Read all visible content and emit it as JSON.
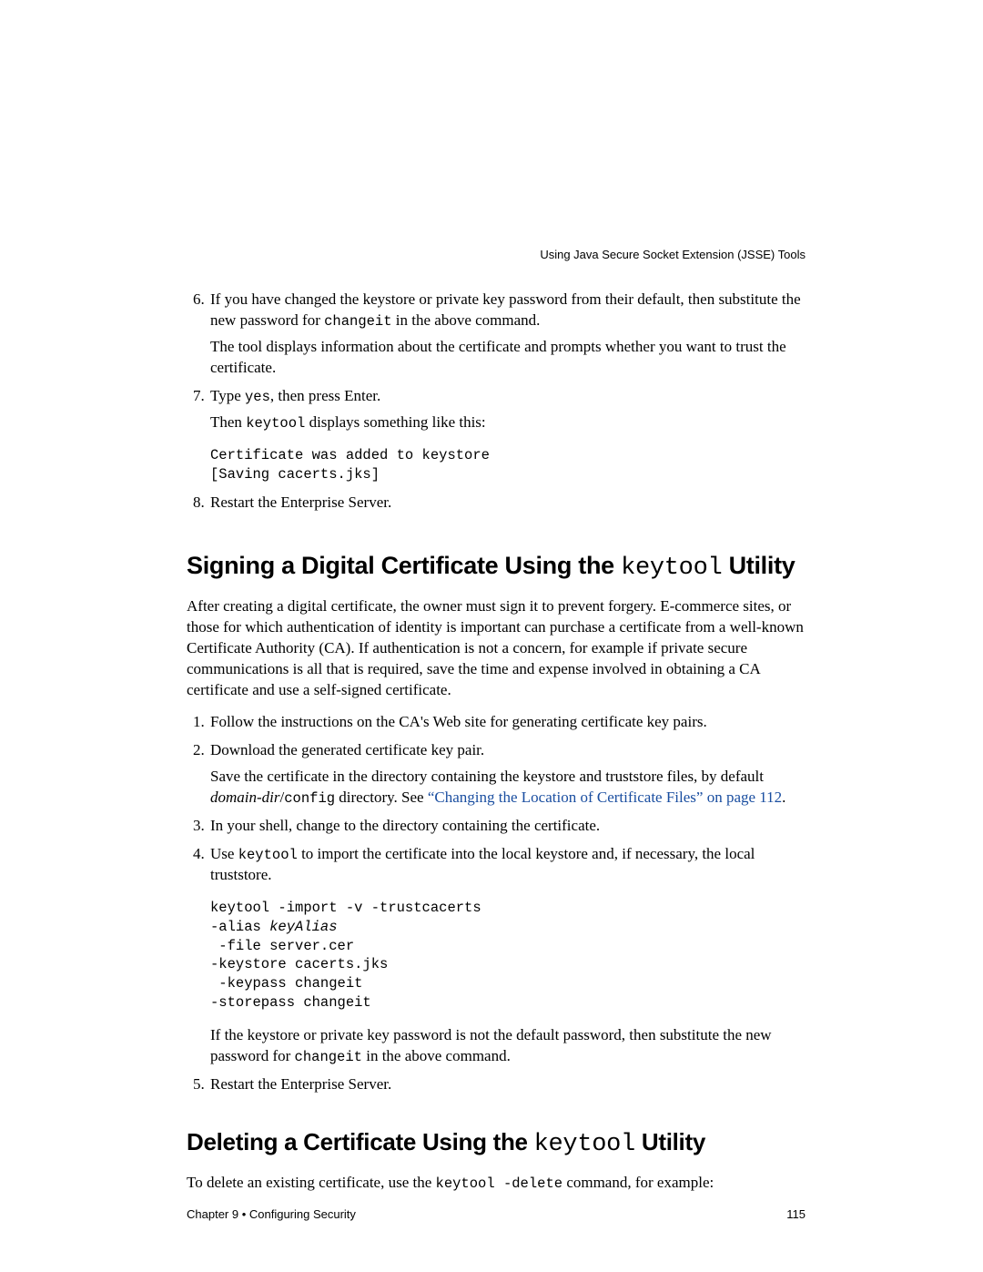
{
  "running_head": "Using Java Secure Socket Extension (JSSE) Tools",
  "list1": {
    "start": 6,
    "items": [
      {
        "text_before": "If you have changed the keystore or private key password from their default, then substitute the new password for ",
        "code1": "changeit",
        "text_after_code1": " in the above command.",
        "para2": "The tool displays information about the certificate and prompts whether you want to trust the certificate."
      },
      {
        "text_before": "Type ",
        "code1": "yes",
        "text_after_code1": ", then press Enter.",
        "para2_before": "Then ",
        "para2_code": "keytool",
        "para2_after": " displays something like this:",
        "pre": "Certificate was added to keystore\n[Saving cacerts.jks]"
      },
      {
        "text_before": "Restart the Enterprise Server."
      }
    ]
  },
  "h2a_before": "Signing a Digital Certificate Using the ",
  "h2a_code": "keytool",
  "h2a_after": " Utility",
  "para_after_h2a": "After creating a digital certificate, the owner must sign it to prevent forgery. E-commerce sites, or those for which authentication of identity is important can purchase a certificate from a well-known Certificate Authority (CA). If authentication is not a concern, for example if private secure communications is all that is required, save the time and expense involved in obtaining a CA certificate and use a self-signed certificate.",
  "list2": {
    "items": [
      {
        "text": "Follow the instructions on the CA's Web site for generating certificate key pairs."
      },
      {
        "text": "Download the generated certificate key pair.",
        "para2_before": "Save the certificate in the directory containing the keystore and truststore files, by default ",
        "para2_italic": "domain-dir",
        "para2_slash": "/",
        "para2_code": "config",
        "para2_mid": " directory. See ",
        "para2_link": "“Changing the Location of Certificate Files” on page 112",
        "para2_end": "."
      },
      {
        "text": "In your shell, change to the directory containing the certificate."
      },
      {
        "text_before": "Use ",
        "code1": "keytool",
        "text_after": " to import the certificate into the local keystore and, if necessary, the local truststore.",
        "pre_before": "keytool -import -v -trustcacerts\n-alias ",
        "pre_italic": "keyAlias",
        "pre_after": "\n -file server.cer\n-keystore cacerts.jks\n -keypass changeit\n-storepass changeit",
        "para3_before": "If the keystore or private key password is not the default password, then substitute the new password for ",
        "para3_code": "changeit",
        "para3_after": " in the above command."
      },
      {
        "text": "Restart the Enterprise Server."
      }
    ]
  },
  "h2b_before": "Deleting a Certificate Using the ",
  "h2b_code": "keytool",
  "h2b_after": " Utility",
  "para_after_h2b_before": "To delete an existing certificate, use the ",
  "para_after_h2b_code": "keytool -delete",
  "para_after_h2b_after": " command, for example:",
  "footer": {
    "left": "Chapter 9  •  Configuring Security",
    "right": "115"
  }
}
